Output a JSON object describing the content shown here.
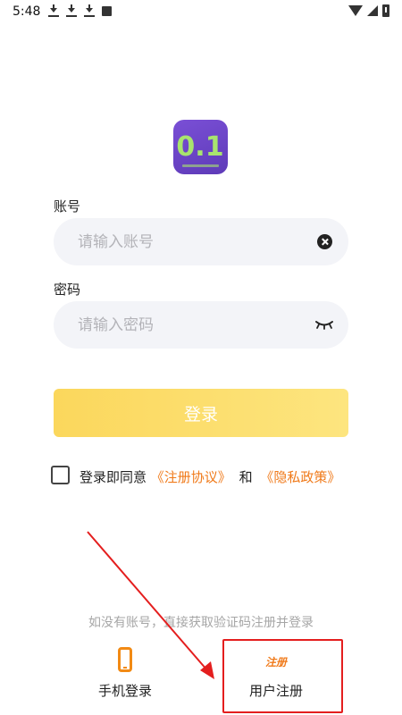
{
  "status_bar": {
    "time": "5:48",
    "icons_left": [
      "download-icon",
      "download-icon",
      "download-icon",
      "text-app-icon"
    ],
    "icons_right": [
      "wifi-icon",
      "signal-icon",
      "battery-icon"
    ]
  },
  "logo": {
    "text": "0.1"
  },
  "account": {
    "label": "账号",
    "placeholder": "请输入账号",
    "value": ""
  },
  "password": {
    "label": "密码",
    "placeholder": "请输入密码",
    "value": ""
  },
  "login_button": {
    "label": "登录"
  },
  "agreement": {
    "prefix": "登录即同意",
    "terms_link": "《注册协议》",
    "and": "和",
    "privacy_link": "《隐私政策》",
    "checked": false
  },
  "footer": {
    "hint": "如没有账号，直接获取验证码注册并登录",
    "methods": [
      {
        "icon": "phone-icon",
        "label": "手机登录"
      },
      {
        "icon": "register-icon",
        "icon_text": "注册",
        "label": "用户注册"
      }
    ]
  },
  "colors": {
    "accent_orange": "#f07a1a",
    "button_yellow": "#fbd75c",
    "logo_purple": "#6d45c8",
    "annotation_red": "#e41e1e"
  }
}
